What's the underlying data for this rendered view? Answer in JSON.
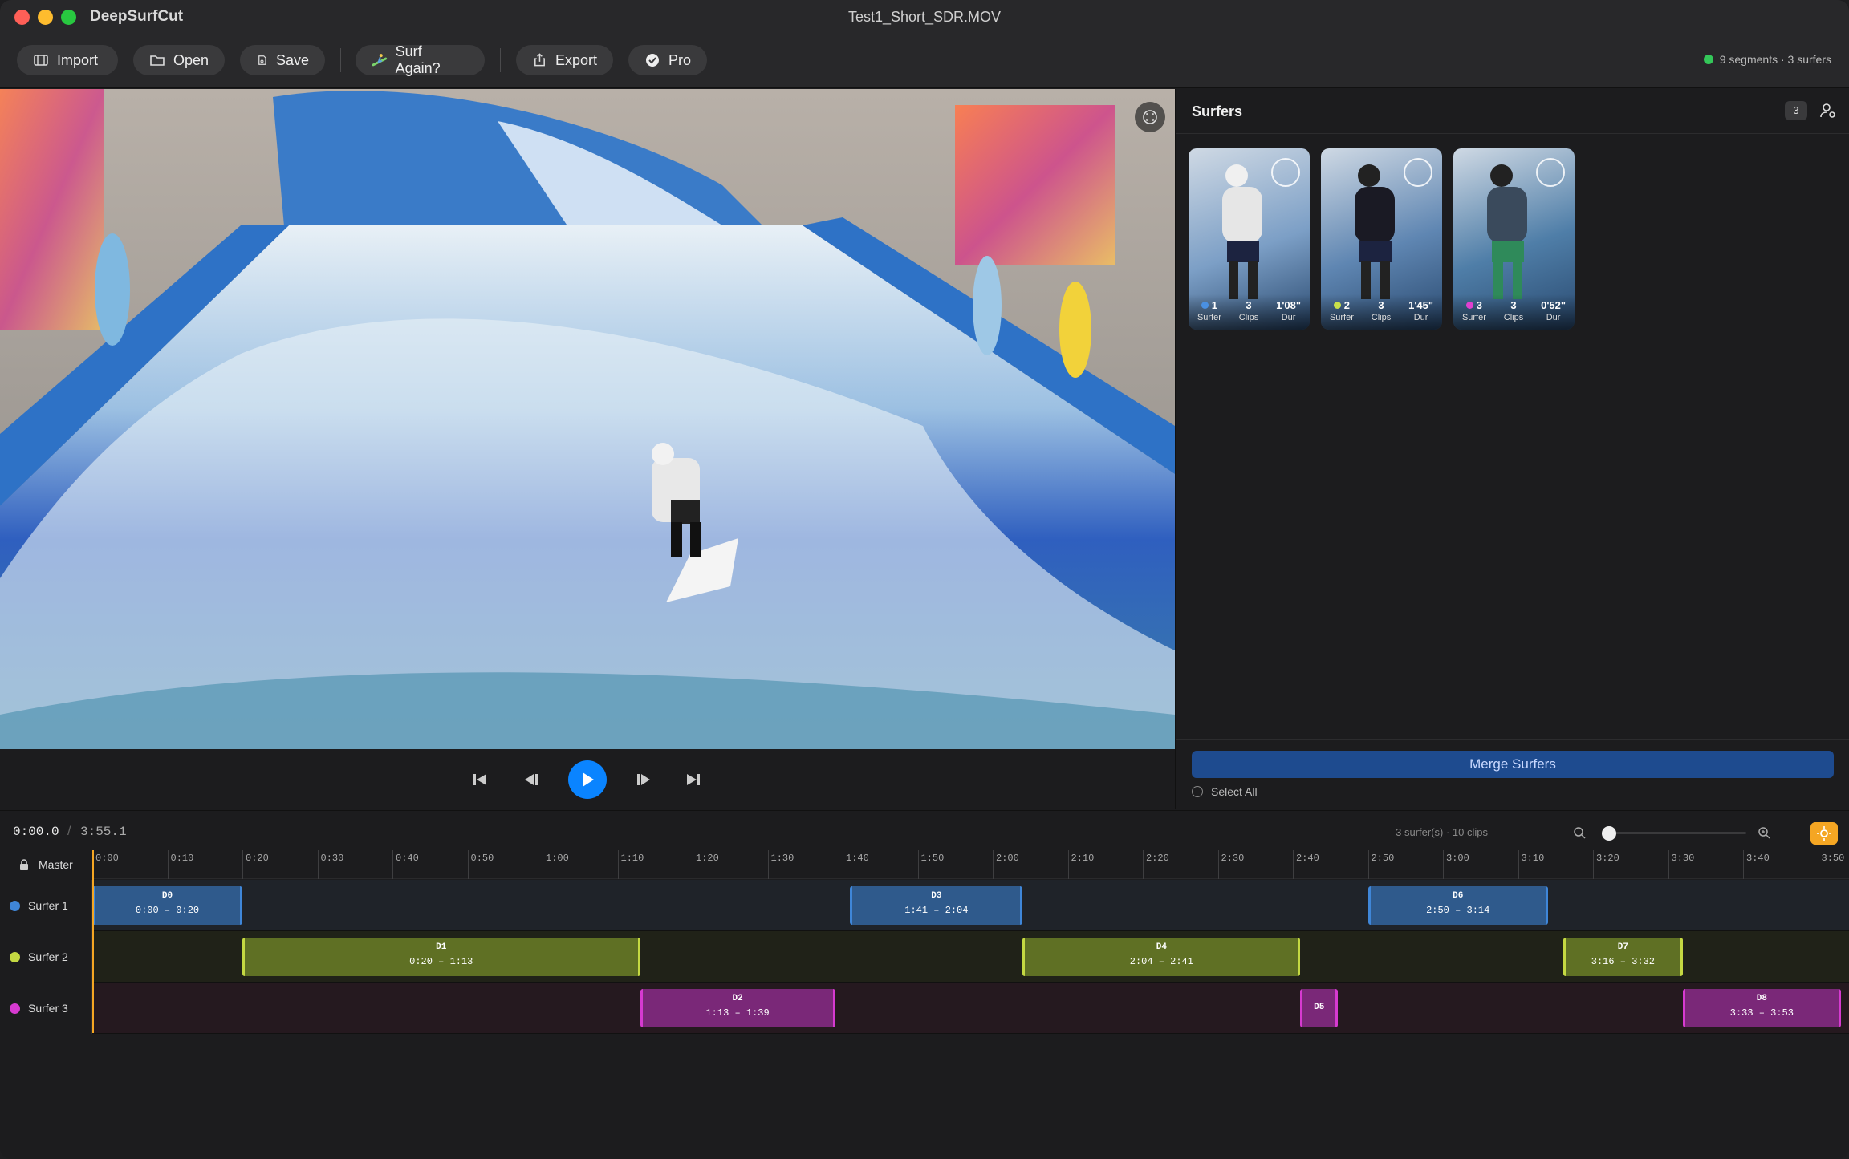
{
  "app": {
    "name": "DeepSurfCut",
    "document_title": "Test1_Short_SDR.MOV"
  },
  "toolbar": {
    "import_label": "Import",
    "open_label": "Open",
    "save_label": "Save",
    "surf_again_label": "Surf Again?",
    "export_label": "Export",
    "pro_label": "Pro",
    "status_text": "9 segments · 3 surfers",
    "status_color": "#34c759"
  },
  "sidebar": {
    "title": "Surfers",
    "count": "3",
    "surfers": [
      {
        "num": "1",
        "clips": "3",
        "dur": "1'08\"",
        "surfer_label": "Surfer",
        "clips_label": "Clips",
        "dur_label": "Dur",
        "color": "#4a90e2"
      },
      {
        "num": "2",
        "clips": "3",
        "dur": "1'45\"",
        "surfer_label": "Surfer",
        "clips_label": "Clips",
        "dur_label": "Dur",
        "color": "#c8e04a"
      },
      {
        "num": "3",
        "clips": "3",
        "dur": "0'52\"",
        "surfer_label": "Surfer",
        "clips_label": "Clips",
        "dur_label": "Dur",
        "color": "#e040d0"
      }
    ],
    "merge_label": "Merge Surfers",
    "select_all_label": "Select All"
  },
  "timeline": {
    "current_time": "0:00.0",
    "separator": "/",
    "total_duration": "3:55.1",
    "info": "3 surfer(s) · 10 clips",
    "zoom_level": 0,
    "master_label": "Master",
    "ruler": [
      "0:00",
      "0:10",
      "0:20",
      "0:30",
      "0:40",
      "0:50",
      "1:00",
      "1:10",
      "1:20",
      "1:30",
      "1:40",
      "1:50",
      "2:00",
      "2:10",
      "2:20",
      "2:30",
      "2:40",
      "2:50",
      "3:00",
      "3:10",
      "3:20",
      "3:30",
      "3:40",
      "3:50"
    ],
    "tracks": [
      {
        "label": "Surfer 1",
        "color": "#3f86d8",
        "clip_fill": "#2f5a8c",
        "row_bg": "#1f2329",
        "clips": [
          {
            "name": "D0",
            "range": "0:00 – 0:20",
            "start": 0,
            "end": 20
          },
          {
            "name": "D3",
            "range": "1:41 – 2:04",
            "start": 101,
            "end": 124
          },
          {
            "name": "D6",
            "range": "2:50 – 3:14",
            "start": 170,
            "end": 194
          }
        ]
      },
      {
        "label": "Surfer 2",
        "color": "#c4d842",
        "clip_fill": "#5f7024",
        "row_bg": "#202218",
        "clips": [
          {
            "name": "D1",
            "range": "0:20 – 1:13",
            "start": 20,
            "end": 73
          },
          {
            "name": "D4",
            "range": "2:04 – 2:41",
            "start": 124,
            "end": 161
          },
          {
            "name": "D7",
            "range": "3:16 – 3:32",
            "start": 196,
            "end": 212
          }
        ]
      },
      {
        "label": "Surfer 3",
        "color": "#d63ad0",
        "clip_fill": "#7a2878",
        "row_bg": "#25191f",
        "clips": [
          {
            "name": "D2",
            "range": "1:13 – 1:39",
            "start": 73,
            "end": 99
          },
          {
            "name": "D5",
            "range": "",
            "start": 161,
            "end": 166
          },
          {
            "name": "D8",
            "range": "3:33 – 3:53",
            "start": 212,
            "end": 233
          }
        ]
      }
    ]
  }
}
